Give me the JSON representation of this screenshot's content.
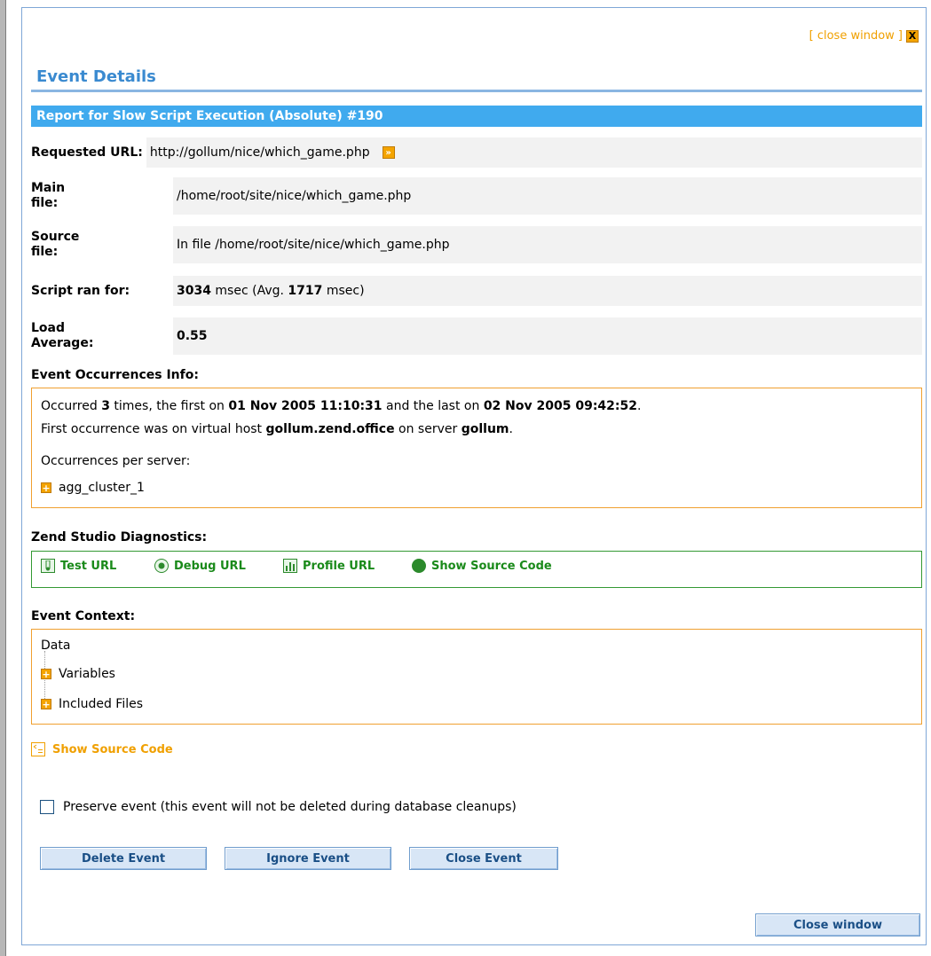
{
  "header": {
    "close_link_text": "[ close window ]",
    "close_x": "X",
    "title": "Event Details",
    "report_title": "Report for Slow Script Execution (Absolute) #190"
  },
  "details": {
    "requested_url_label": "Requested URL:",
    "requested_url_value": "http://gollum/nice/which_game.php",
    "main_file_label_1": "Main",
    "main_file_label_2": "file:",
    "main_file_value": "/home/root/site/nice/which_game.php",
    "source_file_label_1": "Source",
    "source_file_label_2": "file:",
    "source_file_value": "In file /home/root/site/nice/which_game.php",
    "script_ran_label": "Script ran for:",
    "script_ran_msec": "3034",
    "script_ran_mid": " msec (Avg. ",
    "script_ran_avg": "1717",
    "script_ran_end": " msec)",
    "load_avg_label_1": "Load",
    "load_avg_label_2": "Average:",
    "load_avg_value": "0.55"
  },
  "occurrences": {
    "heading": "Event Occurrences Info:",
    "line1_a": "Occurred ",
    "line1_count": "3",
    "line1_b": " times, the first on ",
    "line1_first": "01 Nov 2005 11:10:31",
    "line1_c": " and the last on ",
    "line1_last": "02 Nov 2005 09:42:52",
    "line1_d": ".",
    "line2_a": "First occurrence was on virtual host ",
    "line2_host": "gollum.zend.office",
    "line2_b": " on server ",
    "line2_server": "gollum",
    "line2_c": ".",
    "per_server_label": "Occurrences per server:",
    "cluster": "agg_cluster_1"
  },
  "diagnostics": {
    "heading": "Zend Studio Diagnostics:",
    "test_url": "Test URL",
    "debug_url": "Debug URL",
    "profile_url": "Profile URL",
    "show_source": "Show Source Code"
  },
  "context": {
    "heading": "Event Context:",
    "data_label": "Data",
    "variables": "Variables",
    "included_files": "Included Files"
  },
  "show_source_link": "Show Source Code",
  "preserve_label": "Preserve event (this event will not be deleted during database cleanups)",
  "buttons": {
    "delete": "Delete Event",
    "ignore": "Ignore Event",
    "close_event": "Close Event",
    "close_window": "Close window"
  },
  "colors": {
    "accent_blue": "#40aaee",
    "title_blue": "#3a8ad0",
    "orange": "#f0a000",
    "green": "#1a8a1a"
  }
}
